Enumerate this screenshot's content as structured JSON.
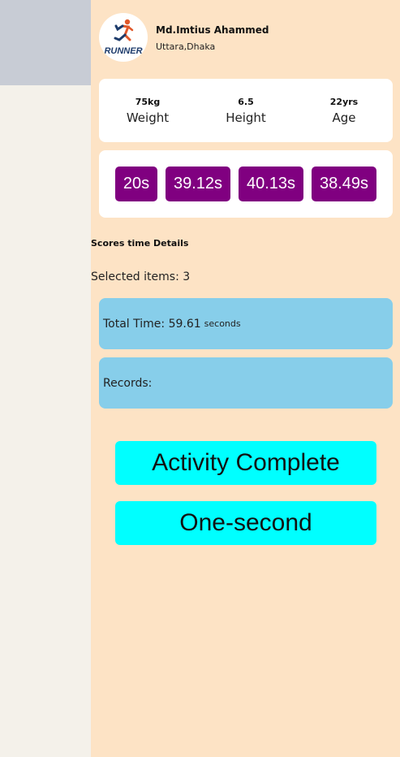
{
  "profile": {
    "name": "Md.Imtius Ahammed",
    "location": "Uttara,Dhaka",
    "logo_text": "RUNNER"
  },
  "stats": [
    {
      "value": "75kg",
      "label": "Weight"
    },
    {
      "value": "6.5",
      "label": "Height"
    },
    {
      "value": "22yrs",
      "label": "Age"
    }
  ],
  "times": [
    "20s",
    "39.12s",
    "40.13s",
    "38.49s"
  ],
  "details": {
    "title": "Scores time Details",
    "selected_label": "Selected items: 3",
    "total_label": "Total Time: 59.61",
    "total_unit": "seconds",
    "records_label": "Records:"
  },
  "actions": {
    "activity_complete": "Activity Complete",
    "one_second": "One-second"
  },
  "colors": {
    "panel_bg": "#fde3c5",
    "chip_bg": "#800080",
    "info_bg": "#87ceea",
    "button_bg": "#00ffff"
  }
}
